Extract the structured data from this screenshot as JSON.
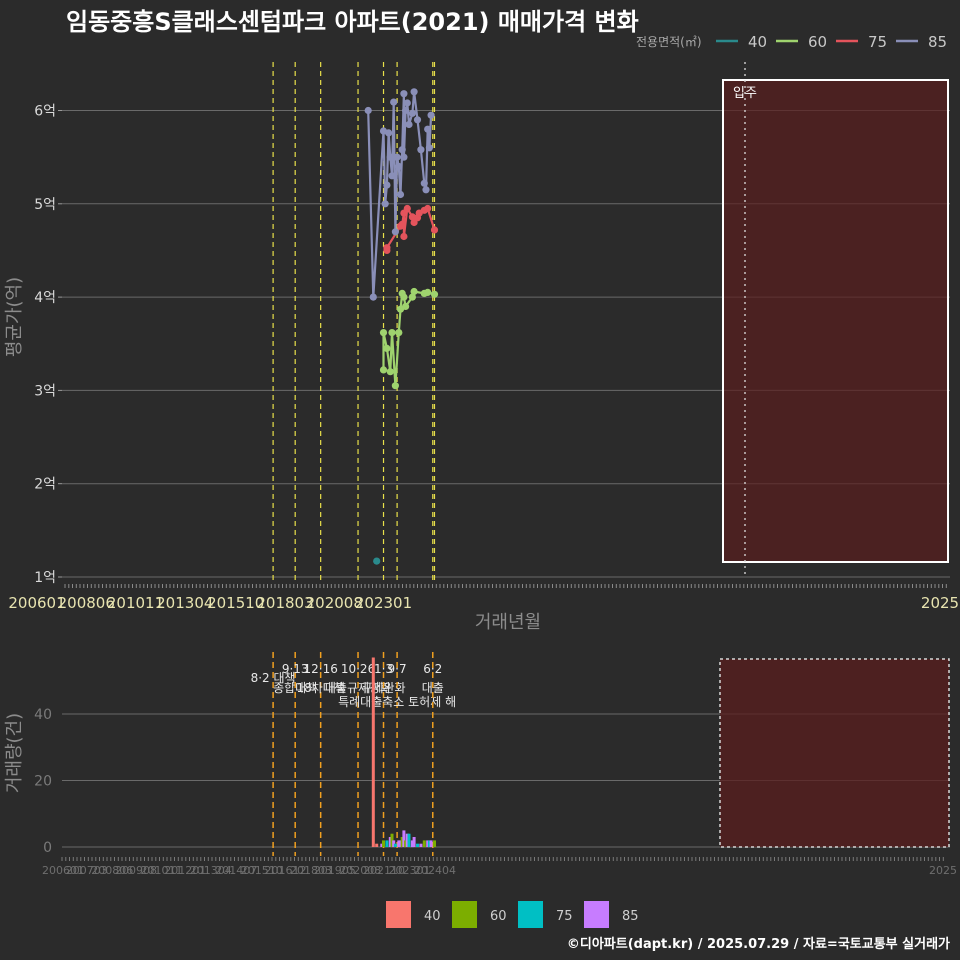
{
  "title": "임동중흥S클래스센텀파크 아파트(2021) 매매가격 변화",
  "footer": "©디아파트(dapt.kr) / 2025.07.29 / 자료=국토교통부 실거래가",
  "legend_top": {
    "title": "전용면적(㎡)",
    "items": [
      {
        "label": "40",
        "color": "#2a8a8c"
      },
      {
        "label": "60",
        "color": "#9fd36e"
      },
      {
        "label": "75",
        "color": "#e4545c"
      },
      {
        "label": "85",
        "color": "#8a8fb8"
      }
    ]
  },
  "legend_bottom": {
    "items": [
      {
        "label": "40",
        "color": "#f8766d"
      },
      {
        "label": "60",
        "color": "#7cae00"
      },
      {
        "label": "75",
        "color": "#00bfc4"
      },
      {
        "label": "85",
        "color": "#c77cff"
      }
    ]
  },
  "chart_data": [
    {
      "type": "line",
      "name": "price",
      "xlabel": "거래년월",
      "ylabel": "평균가(억)",
      "x_ticks": [
        "200601",
        "200806",
        "201011",
        "201304",
        "201510",
        "201803",
        "202008",
        "202301",
        "2025"
      ],
      "y_ticks": [
        "1억",
        "2억",
        "3억",
        "4억",
        "5억",
        "6억"
      ],
      "ylim": [
        1,
        6.5
      ],
      "grid": "horizontal",
      "policy_lines": [
        "2017-08",
        "2018-09",
        "2019-12",
        "2021-10",
        "2023-01",
        "2023-09",
        "2025-06",
        "2025-07"
      ],
      "move_in": {
        "label": "입주",
        "date": "2020-12"
      },
      "series": [
        {
          "name": "40",
          "color": "#2a8a8c",
          "points": [
            [
              "2022-09",
              1.17
            ]
          ]
        },
        {
          "name": "60",
          "color": "#9fd36e",
          "points": [
            [
              "2023-01",
              3.22
            ],
            [
              "2023-01",
              3.62
            ],
            [
              "2023-03",
              3.45
            ],
            [
              "2023-05",
              3.2
            ],
            [
              "2023-06",
              3.62
            ],
            [
              "2023-08",
              3.05
            ],
            [
              "2023-10",
              3.62
            ],
            [
              "2023-11",
              3.87
            ],
            [
              "2023-12",
              4.04
            ],
            [
              "2024-01",
              4.0
            ],
            [
              "2024-02",
              3.9
            ],
            [
              "2024-06",
              4.0
            ],
            [
              "2024-07",
              4.06
            ],
            [
              "2025-01",
              4.04
            ],
            [
              "2025-03",
              4.05
            ],
            [
              "2025-07",
              4.03
            ]
          ]
        },
        {
          "name": "75",
          "color": "#e4545c",
          "points": [
            [
              "2023-03",
              4.5
            ],
            [
              "2023-03",
              4.53
            ],
            [
              "2023-11",
              4.76
            ],
            [
              "2023-12",
              4.78
            ],
            [
              "2024-01",
              4.9
            ],
            [
              "2024-01",
              4.65
            ],
            [
              "2024-03",
              4.95
            ],
            [
              "2024-06",
              4.86
            ],
            [
              "2024-07",
              4.8
            ],
            [
              "2024-09",
              4.85
            ],
            [
              "2024-10",
              4.9
            ],
            [
              "2025-01",
              4.93
            ],
            [
              "2025-03",
              4.95
            ],
            [
              "2025-07",
              4.72
            ]
          ]
        },
        {
          "name": "85",
          "color": "#8a8fb8",
          "points": [
            [
              "2022-04",
              6.0
            ],
            [
              "2022-07",
              4.0
            ],
            [
              "2023-01",
              5.78
            ],
            [
              "2023-02",
              5.0
            ],
            [
              "2023-03",
              5.2
            ],
            [
              "2023-04",
              5.76
            ],
            [
              "2023-05",
              5.5
            ],
            [
              "2023-06",
              5.3
            ],
            [
              "2023-07",
              6.09
            ],
            [
              "2023-08",
              4.7
            ],
            [
              "2023-09",
              5.5
            ],
            [
              "2023-10",
              5.4
            ],
            [
              "2023-11",
              5.1
            ],
            [
              "2023-12",
              5.58
            ],
            [
              "2024-01",
              6.18
            ],
            [
              "2024-01",
              5.5
            ],
            [
              "2024-02",
              6.0
            ],
            [
              "2024-03",
              6.08
            ],
            [
              "2024-04",
              5.85
            ],
            [
              "2024-06",
              5.97
            ],
            [
              "2024-07",
              6.2
            ],
            [
              "2024-09",
              5.9
            ],
            [
              "2024-11",
              5.58
            ],
            [
              "2025-01",
              5.22
            ],
            [
              "2025-02",
              5.15
            ],
            [
              "2025-03",
              5.8
            ],
            [
              "2025-04",
              5.6
            ],
            [
              "2025-05",
              5.95
            ]
          ]
        }
      ]
    },
    {
      "type": "bar",
      "name": "volume",
      "ylabel": "거래량(건)",
      "y_ticks": [
        "0",
        "20",
        "40"
      ],
      "ylim": [
        0,
        57
      ],
      "x_ticks": [
        "200601",
        "200703",
        "200806",
        "200908",
        "201011",
        "201201",
        "201304",
        "201407",
        "201510",
        "201612",
        "201803",
        "201905",
        "202008",
        "202110",
        "202301",
        "202404",
        "2025"
      ],
      "policy_annotations": [
        {
          "date": "2017-08",
          "label": "8·2 대책"
        },
        {
          "date": "2018-09",
          "label": "9·13",
          "label2": "종합대책"
        },
        {
          "date": "2019-12",
          "label": "12·16",
          "label2": "18차대책"
        },
        {
          "date": "2021-10",
          "label": "10·26",
          "label2": "대출규제강화"
        },
        {
          "date": "2023-01",
          "label": "1·3",
          "label2": "규제완화"
        },
        {
          "date": "2023-09",
          "label": "9·7",
          "label2": "특례대출축소 토허제 해"
        },
        {
          "date": "2025-06",
          "label": "6·2",
          "label2": "대출"
        }
      ],
      "bars": [
        {
          "date": "2022-07",
          "series": "40",
          "value": 57
        },
        {
          "date": "2022-09",
          "series": "40",
          "value": 1
        },
        {
          "date": "2022-12",
          "series": "85",
          "value": 1
        },
        {
          "date": "2023-01",
          "series": "60",
          "value": 2
        },
        {
          "date": "2023-03",
          "series": "75",
          "value": 2
        },
        {
          "date": "2023-05",
          "series": "85",
          "value": 3
        },
        {
          "date": "2023-06",
          "series": "60",
          "value": 4
        },
        {
          "date": "2023-07",
          "series": "85",
          "value": 2
        },
        {
          "date": "2023-08",
          "series": "75",
          "value": 1
        },
        {
          "date": "2023-10",
          "series": "85",
          "value": 2
        },
        {
          "date": "2023-11",
          "series": "85",
          "value": 2
        },
        {
          "date": "2023-12",
          "series": "60",
          "value": 3
        },
        {
          "date": "2024-01",
          "series": "85",
          "value": 5
        },
        {
          "date": "2024-02",
          "series": "60",
          "value": 2
        },
        {
          "date": "2024-03",
          "series": "85",
          "value": 4
        },
        {
          "date": "2024-04",
          "series": "75",
          "value": 4
        },
        {
          "date": "2024-06",
          "series": "85",
          "value": 2
        },
        {
          "date": "2024-07",
          "series": "85",
          "value": 3
        },
        {
          "date": "2024-09",
          "series": "75",
          "value": 1
        },
        {
          "date": "2024-11",
          "series": "85",
          "value": 1
        },
        {
          "date": "2025-01",
          "series": "60",
          "value": 2
        },
        {
          "date": "2025-03",
          "series": "85",
          "value": 2
        },
        {
          "date": "2025-04",
          "series": "75",
          "value": 2
        },
        {
          "date": "2025-05",
          "series": "85",
          "value": 2
        },
        {
          "date": "2025-07",
          "series": "60",
          "value": 2
        }
      ]
    }
  ]
}
